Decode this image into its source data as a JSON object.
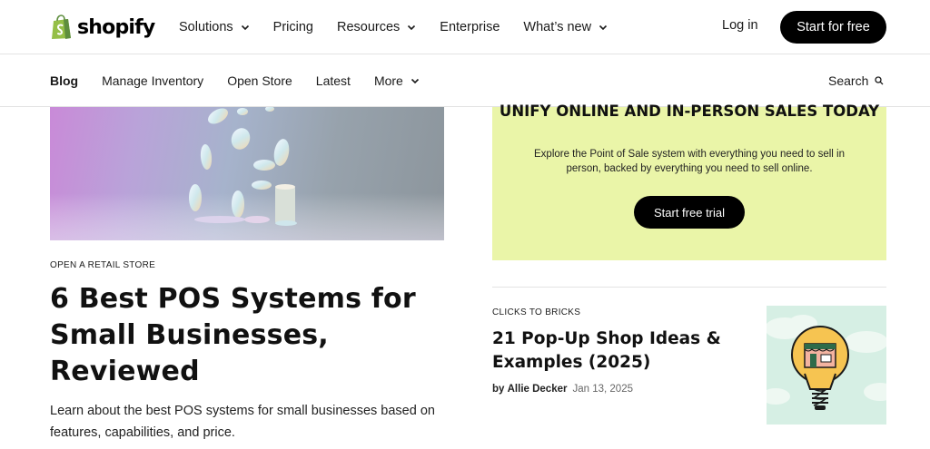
{
  "header": {
    "logo_text": "shopify",
    "nav": [
      {
        "label": "Solutions",
        "has_dropdown": true
      },
      {
        "label": "Pricing",
        "has_dropdown": false
      },
      {
        "label": "Resources",
        "has_dropdown": true
      },
      {
        "label": "Enterprise",
        "has_dropdown": false
      },
      {
        "label": "What’s new",
        "has_dropdown": true
      }
    ],
    "login_label": "Log in",
    "cta_label": "Start for free"
  },
  "subnav": {
    "items": [
      {
        "label": "Blog",
        "active": true
      },
      {
        "label": "Manage Inventory"
      },
      {
        "label": "Open Store"
      },
      {
        "label": "Latest"
      },
      {
        "label": "More",
        "has_dropdown": true
      }
    ],
    "search_label": "Search"
  },
  "featured": {
    "category": "OPEN A RETAIL STORE",
    "title": "6 Best POS Systems for Small Businesses, Reviewed",
    "description": "Learn about the best POS systems for small businesses based on features, capabilities, and price."
  },
  "promo": {
    "title": "UNIFY ONLINE AND IN-PERSON SALES TODAY",
    "text": "Explore the Point of Sale system with everything you need to sell in person, backed by everything you need to sell online.",
    "button_label": "Start free trial",
    "bg_color": "#eaf5a8"
  },
  "article": {
    "category": "CLICKS TO BRICKS",
    "title": "21 Pop-Up Shop Ideas & Examples (2025)",
    "byline_prefix": "by",
    "author": "Allie Decker",
    "date": "Jan 13, 2025"
  },
  "colors": {
    "brand_green": "#95bf47",
    "button_black": "#000000"
  }
}
